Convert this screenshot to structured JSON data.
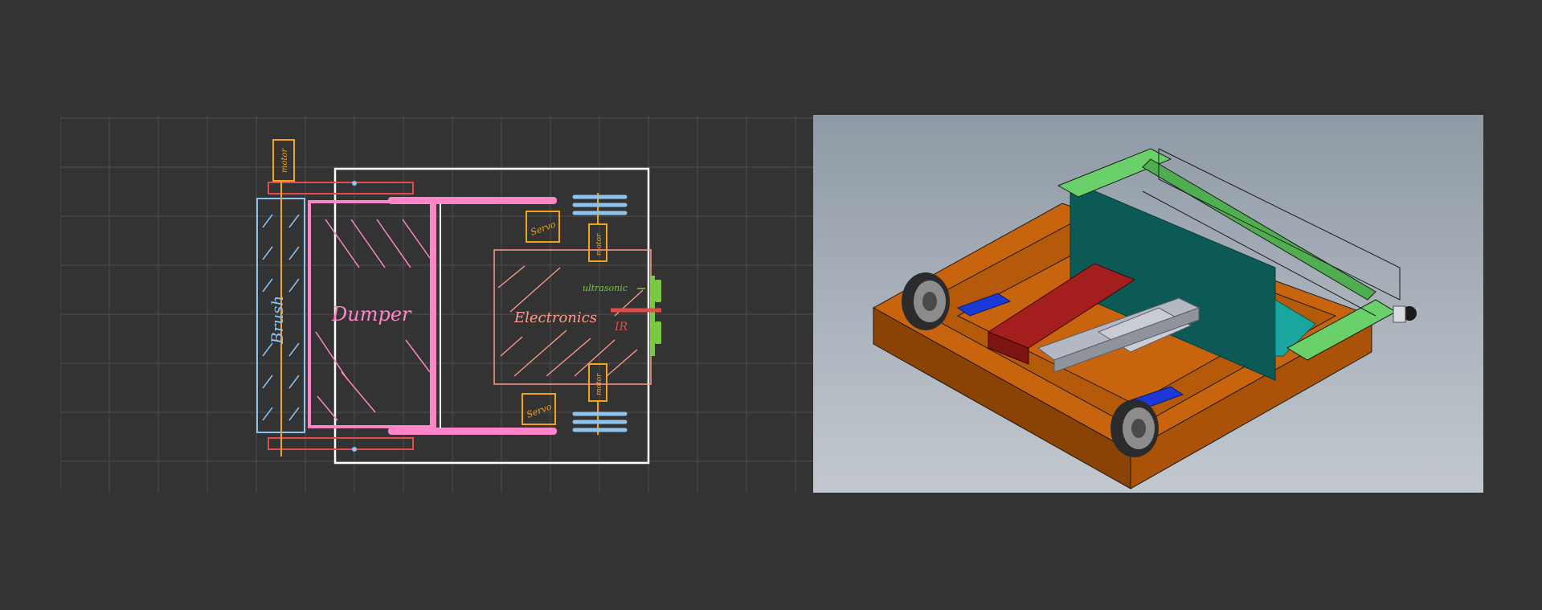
{
  "sketch": {
    "labels": {
      "brush": "Brush",
      "dumper": "Dumper",
      "electronics": "Electronics",
      "servo_top": "Servo",
      "servo_bottom": "Servo",
      "motor": "motor",
      "ultrasonic": "ultrasonic",
      "ir": "IR"
    },
    "colors": {
      "background": "#333333",
      "grid": "#4a4a4a",
      "frame": "#ffffff",
      "brush": "#8ec3ee",
      "dumper": "#ff85c8",
      "servo": "#f2a21b",
      "axle": "#e24b4b",
      "ultrasonic": "#7ac943",
      "ir": "#e24b4b",
      "electronics": "#ff9b8a"
    }
  },
  "render": {
    "colors": {
      "background_top": "#8f9aa6",
      "background_bottom": "#c3c8cf",
      "chassis": "#c8640e",
      "chassis_dark": "#8a4205",
      "roller": "#6ad06a",
      "dumper_plate": "#0b5a55",
      "battery": "#a51e1e",
      "board": "#b4b8c2",
      "motor_driver": "#1b39d6",
      "wheel": "#2b2b2b"
    }
  }
}
